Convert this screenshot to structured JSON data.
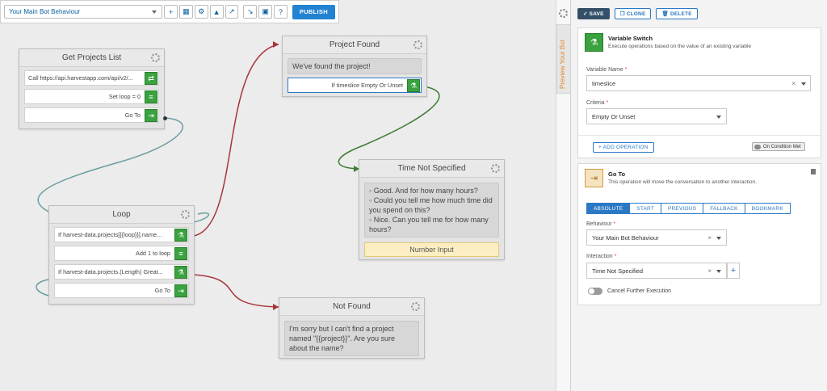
{
  "toolbar": {
    "behaviour_select": "Your Main Bot Behaviour",
    "publish_label": "PUBLISH"
  },
  "nodes": {
    "get_projects": {
      "title": "Get Projects List",
      "rows": [
        "Call https://api.harvestapp.com/api/v2/...",
        "Set loop = 0",
        "Go To"
      ]
    },
    "project_found": {
      "title": "Project Found",
      "message": "We've found the project!",
      "rows": [
        "If timeslice Empty Or Unset"
      ]
    },
    "time_not_specified": {
      "title": "Time Not Specified",
      "messages": [
        "Good. And for how many hours?",
        "Could you tell me how much time did you spend on this?",
        "Nice. Can you tell me for how many hours?"
      ],
      "input_label": "Number Input"
    },
    "loop": {
      "title": "Loop",
      "rows": [
        "If harvest-data.projects[{{loop}}].name...",
        "Add 1 to loop",
        "If harvest-data.projects.(Length) Great...",
        "Go To"
      ]
    },
    "not_found": {
      "title": "Not Found",
      "message": "I'm sorry but I can't find a project named \"{{project}}\". Are you sure about the name?"
    }
  },
  "preview_tab": {
    "label": "Preview Your Bot"
  },
  "panel": {
    "actions": {
      "save": "SAVE",
      "clone": "CLONE",
      "delete": "DELETE"
    },
    "variable_switch": {
      "title": "Variable Switch",
      "subtitle": "Execute operations based on the value of an existing variable",
      "variable_name_label": "Variable Name",
      "variable_name_value": "timeslice",
      "criteria_label": "Criteria",
      "criteria_value": "Empty Or Unset",
      "add_operation": "+ ADD OPERATION",
      "on_condition": "On Condition Met"
    },
    "go_to": {
      "title": "Go To",
      "subtitle": "This operation will move the conversation to another interaction.",
      "tabs": [
        "ABSOLUTE",
        "START",
        "PREVIOUS",
        "FALLBACK",
        "BOOKMARK"
      ],
      "behaviour_label": "Behaviour",
      "behaviour_value": "Your Main Bot Behaviour",
      "interaction_label": "Interaction",
      "interaction_value": "Time Not Specified",
      "cancel_label": "Cancel Further Execution"
    }
  },
  "colors": {
    "accent": "#2b78c5",
    "publish": "#2183d2",
    "green_icon": "#3aa23e",
    "link_red": "#a6343a",
    "link_green": "#3f7c32",
    "link_teal": "#6a9ea0"
  }
}
